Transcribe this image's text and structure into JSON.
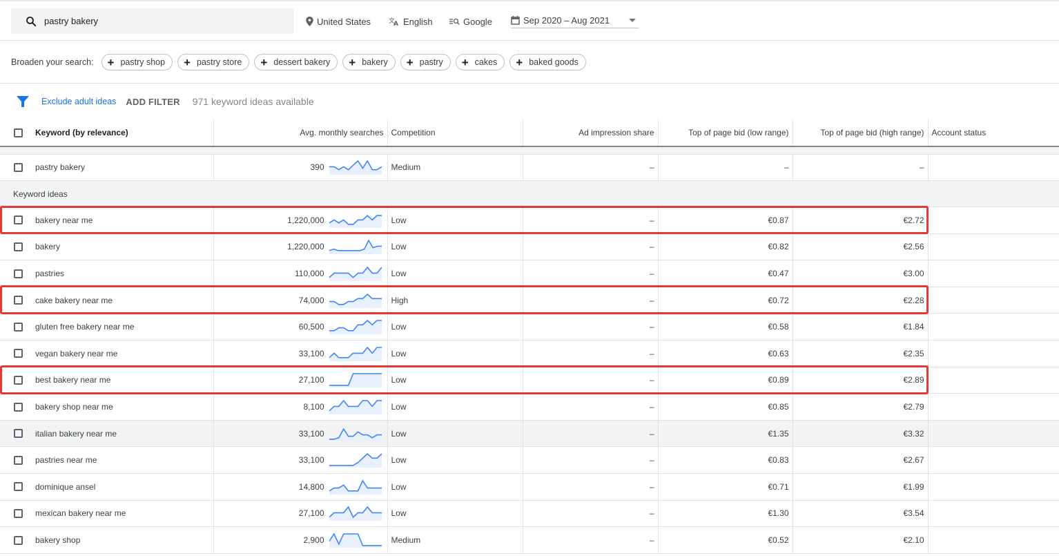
{
  "search": {
    "value": "pastry bakery"
  },
  "toolbar": {
    "location": "United States",
    "language": "English",
    "network": "Google",
    "date_range": "Sep 2020 – Aug 2021"
  },
  "broaden": {
    "label": "Broaden your search:",
    "chips": [
      "pastry shop",
      "pastry store",
      "dessert bakery",
      "bakery",
      "pastry",
      "cakes",
      "baked goods"
    ]
  },
  "filters": {
    "exclude_adult": "Exclude adult ideas",
    "add_filter": "ADD FILTER",
    "count": "971 keyword ideas available"
  },
  "colors": {
    "accent": "#1a73e8",
    "sparkline": "#4285f4",
    "highlight": "#e53935"
  },
  "table": {
    "headers": [
      "Keyword (by relevance)",
      "Avg. monthly searches",
      "Competition",
      "Ad impression share",
      "Top of page bid (low range)",
      "Top of page bid (high range)",
      "Account status"
    ],
    "group_label": "Keyword ideas",
    "searched": {
      "keyword": "pastry bakery",
      "searches": "390",
      "trend": [
        5,
        5,
        3,
        5,
        3,
        6,
        9,
        4,
        9,
        3,
        3,
        5
      ],
      "competition": "Medium",
      "impression": "–",
      "low": "–",
      "high": "–",
      "status": ""
    },
    "rows": [
      {
        "keyword": "bakery near me",
        "searches": "1,220,000",
        "trend": [
          3,
          5,
          3,
          5,
          2,
          2,
          5,
          5,
          8,
          5,
          8,
          8
        ],
        "competition": "Low",
        "impression": "–",
        "low": "€0.87",
        "high": "€2.72",
        "highlighted": true
      },
      {
        "keyword": "bakery",
        "searches": "1,220,000",
        "trend": [
          2,
          3,
          2,
          2,
          2,
          2,
          2,
          2,
          3,
          9,
          4,
          5,
          5
        ],
        "competition": "Low",
        "impression": "–",
        "low": "€0.82",
        "high": "€2.56",
        "highlighted": false
      },
      {
        "keyword": "pastries",
        "searches": "110,000",
        "trend": [
          2,
          5,
          5,
          5,
          5,
          2,
          5,
          5,
          9,
          5,
          5,
          9
        ],
        "competition": "Low",
        "impression": "–",
        "low": "€0.47",
        "high": "€3.00",
        "highlighted": false
      },
      {
        "keyword": "cake bakery near me",
        "searches": "74,000",
        "trend": [
          4,
          4,
          2,
          2,
          4,
          4,
          6,
          6,
          9,
          6,
          6,
          6
        ],
        "competition": "High",
        "impression": "–",
        "low": "€0.72",
        "high": "€2.28",
        "highlighted": true
      },
      {
        "keyword": "gluten free bakery near me",
        "searches": "60,500",
        "trend": [
          2,
          2,
          4,
          4,
          2,
          2,
          6,
          6,
          9,
          6,
          9,
          9
        ],
        "competition": "Low",
        "impression": "–",
        "low": "€0.58",
        "high": "€1.84",
        "highlighted": false
      },
      {
        "keyword": "vegan bakery near me",
        "searches": "33,100",
        "trend": [
          2,
          5,
          2,
          2,
          2,
          5,
          5,
          5,
          9,
          5,
          9,
          9
        ],
        "competition": "Low",
        "impression": "–",
        "low": "€0.63",
        "high": "€2.35",
        "highlighted": false
      },
      {
        "keyword": "best bakery near me",
        "searches": "27,100",
        "trend": [
          1,
          1,
          1,
          1,
          1,
          9,
          9,
          9,
          9,
          9,
          9,
          9
        ],
        "competition": "Low",
        "impression": "–",
        "low": "€0.89",
        "high": "€2.89",
        "highlighted": true
      },
      {
        "keyword": "bakery shop near me",
        "searches": "8,100",
        "trend": [
          2,
          5,
          5,
          9,
          5,
          5,
          5,
          9,
          9,
          5,
          9,
          9
        ],
        "competition": "Low",
        "impression": "–",
        "low": "€0.85",
        "high": "€2.79",
        "highlighted": false
      },
      {
        "keyword": "italian bakery near me",
        "searches": "33,100",
        "trend": [
          1,
          1,
          2,
          8,
          3,
          3,
          6,
          4,
          4,
          2,
          4,
          4
        ],
        "competition": "Low",
        "impression": "–",
        "low": "€1.35",
        "high": "€3.32",
        "highlighted": false,
        "hovered": true
      },
      {
        "keyword": "pastries near me",
        "searches": "33,100",
        "trend": [
          1,
          1,
          1,
          1,
          1,
          1,
          3,
          6,
          9,
          6,
          6,
          9
        ],
        "competition": "Low",
        "impression": "–",
        "low": "€0.83",
        "high": "€2.67",
        "highlighted": false
      },
      {
        "keyword": "dominique ansel",
        "searches": "14,800",
        "trend": [
          2,
          4,
          4,
          6,
          2,
          2,
          2,
          9,
          4,
          4,
          4,
          4
        ],
        "competition": "Low",
        "impression": "–",
        "low": "€0.71",
        "high": "€1.99",
        "highlighted": false
      },
      {
        "keyword": "mexican bakery near me",
        "searches": "27,100",
        "trend": [
          2,
          5,
          5,
          5,
          9,
          2,
          5,
          5,
          9,
          5,
          5,
          5
        ],
        "competition": "Low",
        "impression": "–",
        "low": "€1.30",
        "high": "€3.54",
        "highlighted": false
      },
      {
        "keyword": "bakery shop",
        "searches": "2,900",
        "trend": [
          4,
          9,
          2,
          9,
          9,
          9,
          9,
          1,
          1,
          1,
          1,
          1
        ],
        "competition": "Medium",
        "impression": "–",
        "low": "€0.52",
        "high": "€2.10",
        "highlighted": false
      }
    ]
  }
}
